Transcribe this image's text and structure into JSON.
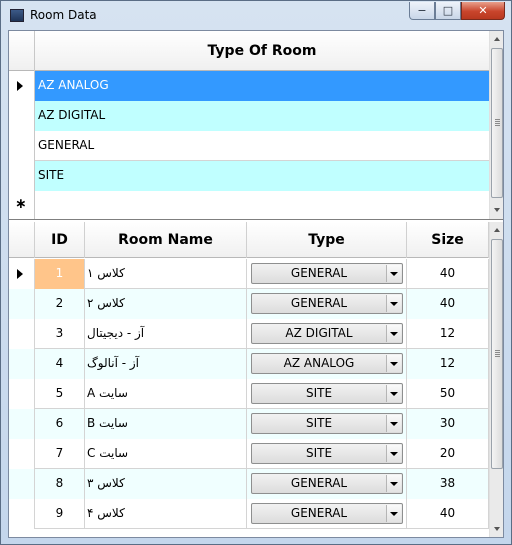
{
  "window": {
    "title": "Room Data",
    "minimize_label": "−",
    "maximize_label": "□",
    "close_label": "✕"
  },
  "room_types": {
    "header": "Type Of Room",
    "rows": [
      {
        "label": "AZ ANALOG"
      },
      {
        "label": "AZ DIGITAL"
      },
      {
        "label": "GENERAL"
      },
      {
        "label": "SITE"
      }
    ],
    "new_row_marker": "∗"
  },
  "rooms": {
    "columns": [
      "ID",
      "Room Name",
      "Type",
      "Size"
    ],
    "rows": [
      {
        "id": "1",
        "name": "کلاس ۱",
        "type": "GENERAL",
        "size": "40"
      },
      {
        "id": "2",
        "name": "کلاس ۲",
        "type": "GENERAL",
        "size": "40"
      },
      {
        "id": "3",
        "name": "آز - دیجیتال",
        "type": "AZ DIGITAL",
        "size": "12"
      },
      {
        "id": "4",
        "name": "آز - آنالوگ",
        "type": "AZ ANALOG",
        "size": "12"
      },
      {
        "id": "5",
        "name": "سایت A",
        "type": "SITE",
        "size": "50"
      },
      {
        "id": "6",
        "name": "سایت B",
        "type": "SITE",
        "size": "30"
      },
      {
        "id": "7",
        "name": "سایت C",
        "type": "SITE",
        "size": "20"
      },
      {
        "id": "8",
        "name": "کلاس ۳",
        "type": "GENERAL",
        "size": "38"
      },
      {
        "id": "9",
        "name": "کلاس ۴",
        "type": "GENERAL",
        "size": "40"
      }
    ]
  },
  "colors": {
    "selected_row": "#3399ff",
    "alt_row_top": "#c0ffff",
    "alt_row_bottom": "#f0ffff",
    "current_cell": "#ffc58a"
  }
}
